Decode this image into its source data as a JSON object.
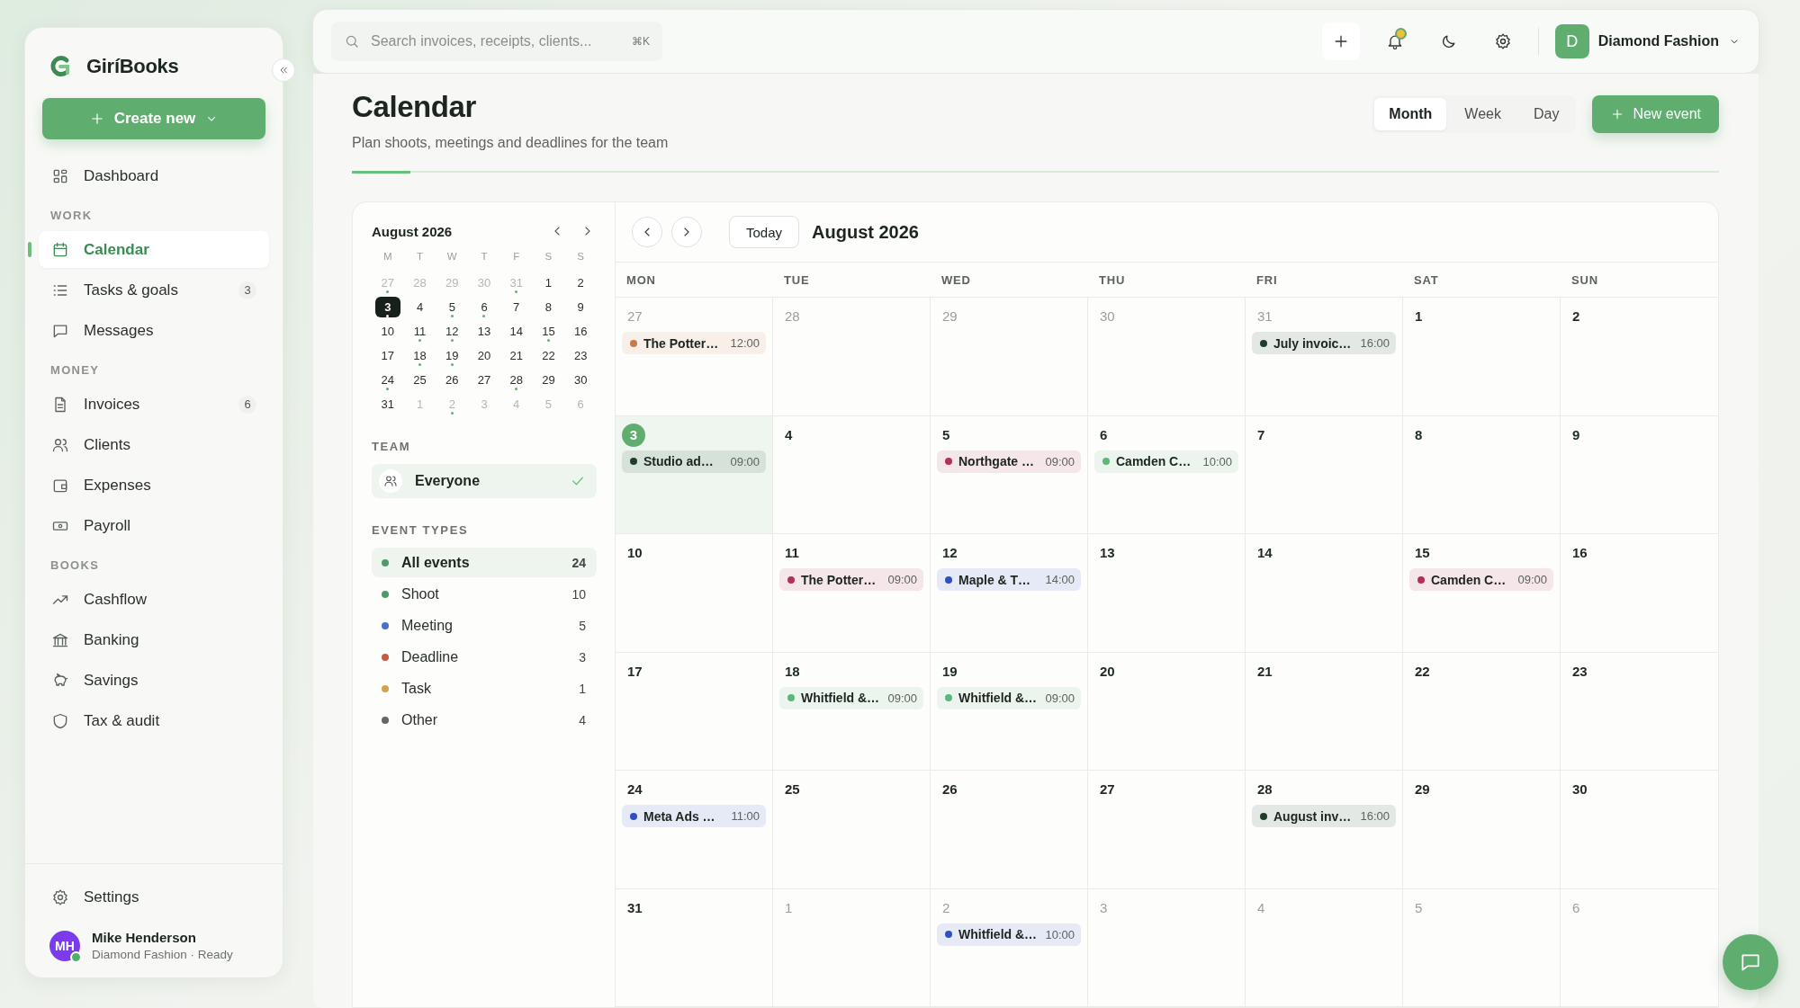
{
  "sidebar": {
    "brand": "GiríBooks",
    "create_button": "Create new",
    "sections": [
      {
        "items": [
          {
            "label": "Dashboard",
            "selected": false
          }
        ]
      },
      {
        "heading": "WORK",
        "items": [
          {
            "label": "Calendar",
            "selected": true
          },
          {
            "label": "Tasks & goals",
            "selected": false,
            "badge": "3"
          },
          {
            "label": "Messages",
            "selected": false
          }
        ]
      },
      {
        "heading": "MONEY",
        "items": [
          {
            "label": "Invoices",
            "selected": false,
            "badge": "6"
          },
          {
            "label": "Clients",
            "selected": false
          },
          {
            "label": "Expenses",
            "selected": false
          },
          {
            "label": "Payroll",
            "selected": false
          }
        ]
      },
      {
        "heading": "BOOKS",
        "items": [
          {
            "label": "Cashflow",
            "selected": false
          },
          {
            "label": "Banking",
            "selected": false
          },
          {
            "label": "Savings",
            "selected": false
          },
          {
            "label": "Tax & audit",
            "selected": false
          }
        ]
      }
    ],
    "settings": "Settings",
    "user": {
      "initials": "MH",
      "name": "Mike Henderson",
      "subtitle": "Diamond Fashion · Ready",
      "online": true
    }
  },
  "top_bar": {
    "search": {
      "placeholder": "Search invoices, receipts, clients...",
      "shortcut": "⌘K"
    },
    "notifications_unread": true,
    "account": {
      "initial": "D",
      "name": "Diamond Fashion"
    }
  },
  "header": {
    "title": "Calendar",
    "subtitle": "Plan shoots, meetings and deadlines for the team",
    "view_tabs": [
      {
        "label": "Month",
        "selected": true
      },
      {
        "label": "Week",
        "selected": false
      },
      {
        "label": "Day",
        "selected": false
      }
    ],
    "new_event_button": "New event"
  },
  "mini_calendar": {
    "title": "August 2026",
    "weekdays": [
      "M",
      "T",
      "W",
      "T",
      "F",
      "S",
      "S"
    ],
    "days": [
      {
        "label": "27",
        "outside": true,
        "dot": true,
        "selected": false
      },
      {
        "label": "28",
        "outside": true,
        "dot": false,
        "selected": false
      },
      {
        "label": "29",
        "outside": true,
        "dot": false,
        "selected": false
      },
      {
        "label": "30",
        "outside": true,
        "dot": false,
        "selected": false
      },
      {
        "label": "31",
        "outside": true,
        "dot": true,
        "selected": false
      },
      {
        "label": "1",
        "outside": false,
        "dot": false,
        "selected": false
      },
      {
        "label": "2",
        "outside": false,
        "dot": false,
        "selected": false
      },
      {
        "label": "3",
        "outside": false,
        "dot": true,
        "selected": true
      },
      {
        "label": "4",
        "outside": false,
        "dot": false,
        "selected": false
      },
      {
        "label": "5",
        "outside": false,
        "dot": true,
        "selected": false
      },
      {
        "label": "6",
        "outside": false,
        "dot": true,
        "selected": false
      },
      {
        "label": "7",
        "outside": false,
        "dot": false,
        "selected": false
      },
      {
        "label": "8",
        "outside": false,
        "dot": false,
        "selected": false
      },
      {
        "label": "9",
        "outside": false,
        "dot": false,
        "selected": false
      },
      {
        "label": "10",
        "outside": false,
        "dot": false,
        "selected": false
      },
      {
        "label": "11",
        "outside": false,
        "dot": true,
        "selected": false
      },
      {
        "label": "12",
        "outside": false,
        "dot": true,
        "selected": false
      },
      {
        "label": "13",
        "outside": false,
        "dot": false,
        "selected": false
      },
      {
        "label": "14",
        "outside": false,
        "dot": false,
        "selected": false
      },
      {
        "label": "15",
        "outside": false,
        "dot": true,
        "selected": false
      },
      {
        "label": "16",
        "outside": false,
        "dot": false,
        "selected": false
      },
      {
        "label": "17",
        "outside": false,
        "dot": false,
        "selected": false
      },
      {
        "label": "18",
        "outside": false,
        "dot": true,
        "selected": false
      },
      {
        "label": "19",
        "outside": false,
        "dot": true,
        "selected": false
      },
      {
        "label": "20",
        "outside": false,
        "dot": false,
        "selected": false
      },
      {
        "label": "21",
        "outside": false,
        "dot": false,
        "selected": false
      },
      {
        "label": "22",
        "outside": false,
        "dot": false,
        "selected": false
      },
      {
        "label": "23",
        "outside": false,
        "dot": false,
        "selected": false
      },
      {
        "label": "24",
        "outside": false,
        "dot": true,
        "selected": false
      },
      {
        "label": "25",
        "outside": false,
        "dot": false,
        "selected": false
      },
      {
        "label": "26",
        "outside": false,
        "dot": false,
        "selected": false
      },
      {
        "label": "27",
        "outside": false,
        "dot": false,
        "selected": false
      },
      {
        "label": "28",
        "outside": false,
        "dot": true,
        "selected": false
      },
      {
        "label": "29",
        "outside": false,
        "dot": false,
        "selected": false
      },
      {
        "label": "30",
        "outside": false,
        "dot": false,
        "selected": false
      },
      {
        "label": "31",
        "outside": false,
        "dot": false,
        "selected": false
      },
      {
        "label": "1",
        "outside": true,
        "dot": false,
        "selected": false
      },
      {
        "label": "2",
        "outside": true,
        "dot": true,
        "selected": false
      },
      {
        "label": "3",
        "outside": true,
        "dot": false,
        "selected": false
      },
      {
        "label": "4",
        "outside": true,
        "dot": false,
        "selected": false
      },
      {
        "label": "5",
        "outside": true,
        "dot": false,
        "selected": false
      },
      {
        "label": "6",
        "outside": true,
        "dot": false,
        "selected": false
      }
    ]
  },
  "team": {
    "heading": "TEAM",
    "items": [
      {
        "label": "Everyone",
        "selected": true
      }
    ]
  },
  "event_types": {
    "heading": "EVENT TYPES",
    "items": [
      {
        "label": "All events",
        "count": "24",
        "color": "#4f9a6a",
        "selected": true
      },
      {
        "label": "Shoot",
        "count": "10",
        "color": "#4f9a6a",
        "selected": false
      },
      {
        "label": "Meeting",
        "count": "5",
        "color": "#4a72c8",
        "selected": false
      },
      {
        "label": "Deadline",
        "count": "3",
        "color": "#c55a45",
        "selected": false
      },
      {
        "label": "Task",
        "count": "1",
        "color": "#d4a24a",
        "selected": false
      },
      {
        "label": "Other",
        "count": "4",
        "color": "#66695f",
        "selected": false
      }
    ]
  },
  "month_view": {
    "today_button": "Today",
    "title": "August 2026",
    "weekdays": [
      "MON",
      "TUE",
      "WED",
      "THU",
      "FRI",
      "SAT",
      "SUN"
    ],
    "weeks": [
      [
        {
          "day": "27",
          "outside": true,
          "today": false,
          "events": [
            {
              "title": "The Potter…",
              "time": "12:00",
              "color": "#c97b45"
            }
          ]
        },
        {
          "day": "28",
          "outside": true,
          "today": false
        },
        {
          "day": "29",
          "outside": true,
          "today": false
        },
        {
          "day": "30",
          "outside": true,
          "today": false
        },
        {
          "day": "31",
          "outside": true,
          "today": false,
          "events": [
            {
              "title": "July invoic…",
              "time": "16:00",
              "color": "#1f3d2b"
            }
          ]
        },
        {
          "day": "1",
          "outside": false,
          "today": false
        },
        {
          "day": "2",
          "outside": false,
          "today": false
        }
      ],
      [
        {
          "day": "3",
          "outside": false,
          "today": true,
          "events": [
            {
              "title": "Studio ad…",
              "time": "09:00",
              "color": "#1f3d2b"
            }
          ]
        },
        {
          "day": "4",
          "outside": false,
          "today": false
        },
        {
          "day": "5",
          "outside": false,
          "today": false,
          "events": [
            {
              "title": "Northgate …",
              "time": "09:00",
              "color": "#b3305a"
            }
          ]
        },
        {
          "day": "6",
          "outside": false,
          "today": false,
          "events": [
            {
              "title": "Camden C…",
              "time": "10:00",
              "color": "#5cb87a"
            }
          ]
        },
        {
          "day": "7",
          "outside": false,
          "today": false
        },
        {
          "day": "8",
          "outside": false,
          "today": false
        },
        {
          "day": "9",
          "outside": false,
          "today": false
        }
      ],
      [
        {
          "day": "10",
          "outside": false,
          "today": false
        },
        {
          "day": "11",
          "outside": false,
          "today": false,
          "events": [
            {
              "title": "The Potter…",
              "time": "09:00",
              "color": "#b3305a"
            }
          ]
        },
        {
          "day": "12",
          "outside": false,
          "today": false,
          "events": [
            {
              "title": "Maple & T…",
              "time": "14:00",
              "color": "#2f4fc4"
            }
          ]
        },
        {
          "day": "13",
          "outside": false,
          "today": false
        },
        {
          "day": "14",
          "outside": false,
          "today": false
        },
        {
          "day": "15",
          "outside": false,
          "today": false,
          "events": [
            {
              "title": "Camden C…",
              "time": "09:00",
              "color": "#b3305a"
            }
          ]
        },
        {
          "day": "16",
          "outside": false,
          "today": false
        }
      ],
      [
        {
          "day": "17",
          "outside": false,
          "today": false
        },
        {
          "day": "18",
          "outside": false,
          "today": false,
          "events": [
            {
              "title": "Whitfield &…",
              "time": "09:00",
              "color": "#5cb87a"
            }
          ]
        },
        {
          "day": "19",
          "outside": false,
          "today": false,
          "events": [
            {
              "title": "Whitfield &…",
              "time": "09:00",
              "color": "#5cb87a"
            }
          ]
        },
        {
          "day": "20",
          "outside": false,
          "today": false
        },
        {
          "day": "21",
          "outside": false,
          "today": false
        },
        {
          "day": "22",
          "outside": false,
          "today": false
        },
        {
          "day": "23",
          "outside": false,
          "today": false
        }
      ],
      [
        {
          "day": "24",
          "outside": false,
          "today": false,
          "events": [
            {
              "title": "Meta Ads …",
              "time": "11:00",
              "color": "#2f4fc4"
            }
          ]
        },
        {
          "day": "25",
          "outside": false,
          "today": false
        },
        {
          "day": "26",
          "outside": false,
          "today": false
        },
        {
          "day": "27",
          "outside": false,
          "today": false
        },
        {
          "day": "28",
          "outside": false,
          "today": false,
          "events": [
            {
              "title": "August inv…",
              "time": "16:00",
              "color": "#1f3d2b"
            }
          ]
        },
        {
          "day": "29",
          "outside": false,
          "today": false
        },
        {
          "day": "30",
          "outside": false,
          "today": false
        }
      ],
      [
        {
          "day": "31",
          "outside": false,
          "today": false
        },
        {
          "day": "1",
          "outside": true,
          "today": false
        },
        {
          "day": "2",
          "outside": true,
          "today": false,
          "events": [
            {
              "title": "Whitfield &…",
              "time": "10:00",
              "color": "#2f4fc4"
            }
          ]
        },
        {
          "day": "3",
          "outside": true,
          "today": false
        },
        {
          "day": "4",
          "outside": true,
          "today": false
        },
        {
          "day": "5",
          "outside": true,
          "today": false
        },
        {
          "day": "6",
          "outside": true,
          "today": false
        }
      ]
    ]
  }
}
